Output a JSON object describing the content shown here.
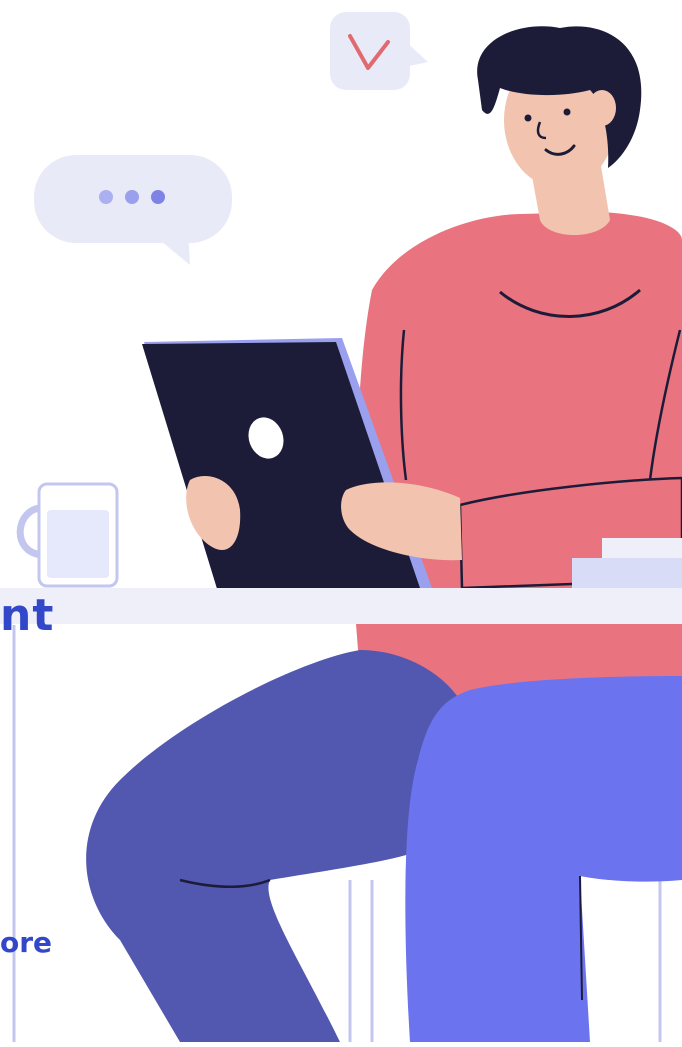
{
  "text_fragments": {
    "heading_fragment": "nt",
    "link_fragment": "ore"
  },
  "illustration": {
    "subject": "person-with-tablet-illustration",
    "colors": {
      "hair": "#1c1c38",
      "skin": "#f2c4b0",
      "shirt": "#e97480",
      "pants_dark": "#5258b0",
      "pants_light": "#6b74ee",
      "tablet": "#1c1c38",
      "tablet_edge": "#9aa0ee",
      "bubble": "#e9eaf8",
      "dots": "#8a90e8",
      "check": "#e06a70",
      "table": "#eeeff9",
      "mug": "#e6e8fb",
      "outline": "#c3c6ee",
      "text_blue": "#3348c8"
    }
  }
}
